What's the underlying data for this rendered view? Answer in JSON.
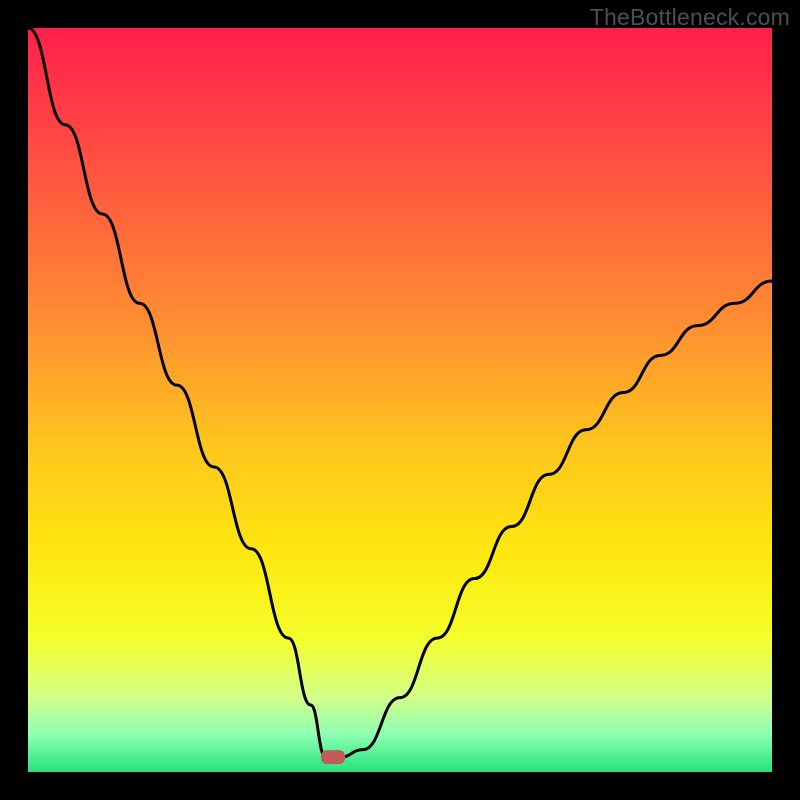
{
  "watermark": "TheBottleneck.com",
  "chart_data": {
    "type": "line",
    "title": "",
    "xlabel": "",
    "ylabel": "",
    "xlim": [
      0,
      100
    ],
    "ylim": [
      0,
      100
    ],
    "x": [
      0,
      5,
      10,
      15,
      20,
      25,
      30,
      35,
      38,
      40,
      42,
      45,
      50,
      55,
      60,
      65,
      70,
      75,
      80,
      85,
      90,
      95,
      100
    ],
    "values": [
      100,
      87,
      75,
      63,
      52,
      41,
      30,
      18,
      9,
      2,
      2,
      3,
      10,
      18,
      26,
      33,
      40,
      46,
      51,
      56,
      60,
      63,
      66
    ],
    "minimum_x": 41,
    "minimum_marker": {
      "x": 41,
      "y": 2,
      "color": "#c35b5b"
    },
    "gradient_stops": [
      {
        "offset": 0.0,
        "color": "#ff1f4b"
      },
      {
        "offset": 0.2,
        "color": "#ff5640"
      },
      {
        "offset": 0.4,
        "color": "#ff8f32"
      },
      {
        "offset": 0.55,
        "color": "#ffc21e"
      },
      {
        "offset": 0.7,
        "color": "#ffe60f"
      },
      {
        "offset": 0.82,
        "color": "#f4ff2a"
      },
      {
        "offset": 0.9,
        "color": "#d2ff88"
      },
      {
        "offset": 0.95,
        "color": "#8dffb4"
      },
      {
        "offset": 1.0,
        "color": "#25e37a"
      }
    ],
    "curve_color": "#000000",
    "curve_width": 3
  }
}
